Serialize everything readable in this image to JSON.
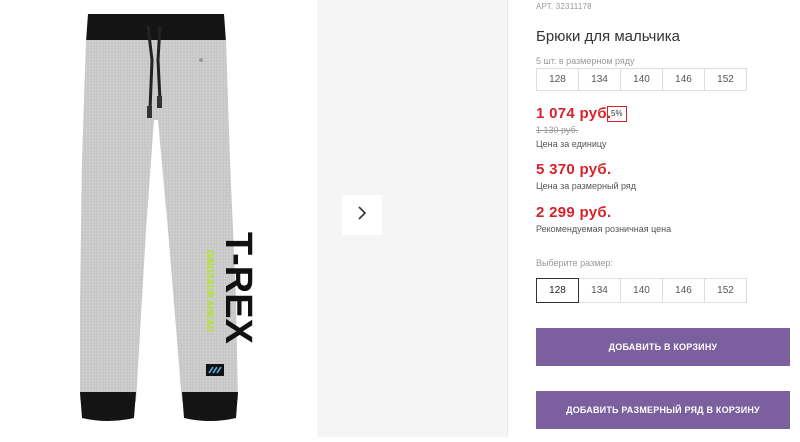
{
  "product": {
    "sku": "АРТ. 32311178",
    "title": "Брюки для мальчика",
    "print_text": "T-REX",
    "print_subtext": "DINOSAUR AHEAD"
  },
  "size_row": {
    "hint": "5 шт. в размерном ряду",
    "sizes": [
      "128",
      "134",
      "140",
      "146",
      "152"
    ]
  },
  "prices": {
    "unit_price": "1 074 руб.",
    "discount_badge": "5%",
    "old_price": "1 130 руб.",
    "unit_caption": "Цена за единицу",
    "row_price": "5 370 руб.",
    "row_caption": "Цена за размерный ряд",
    "retail_price": "2 299 руб.",
    "retail_caption": "Рекомендуемая розничная цена"
  },
  "size_select": {
    "label": "Выберите размер:",
    "options": [
      "128",
      "134",
      "140",
      "146",
      "152"
    ],
    "selected": "128"
  },
  "actions": {
    "add_to_cart": "ДОБАВИТЬ В КОРЗИНУ",
    "add_row_to_cart": "ДОБАВИТЬ РАЗМЕРНЫЙ РЯД В КОРЗИНУ"
  },
  "colors": {
    "price_red": "#d8232a",
    "button_purple": "#7b5f9e",
    "pants_grey": "#c9c9c9",
    "cuff_black": "#111111",
    "print_green": "#b5e61d"
  }
}
